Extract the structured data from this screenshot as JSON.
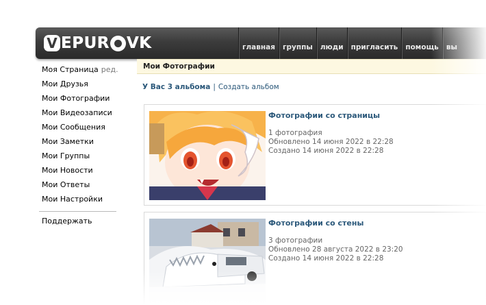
{
  "header": {
    "logo_text": "EPUR",
    "logo_suffix": "VK",
    "nav": [
      "главная",
      "группы",
      "люди",
      "пригласить",
      "помощь",
      "вы"
    ]
  },
  "sidebar": {
    "items": [
      {
        "label": "Моя Страница",
        "extra": "ред."
      },
      {
        "label": "Мои Друзья"
      },
      {
        "label": "Мои Фотографии"
      },
      {
        "label": "Мои Видеозаписи"
      },
      {
        "label": "Мои Сообщения"
      },
      {
        "label": "Мои Заметки"
      },
      {
        "label": "Мои Группы"
      },
      {
        "label": "Мои Новости"
      },
      {
        "label": "Мои Ответы"
      },
      {
        "label": "Мои Настройки"
      }
    ],
    "support": "Поддержать"
  },
  "main": {
    "title": "Мои Фотографии",
    "albums_count": "У Вас 3 альбома",
    "pipe": "|",
    "create_album": "Создать альбом",
    "albums": [
      {
        "title": "Фотографии со страницы",
        "count": "1 фотография",
        "updated": "Обновлено 14 июня 2022 в 22:28",
        "created": "Создано 14 июня 2022 в 22:28"
      },
      {
        "title": "Фотографии со стены",
        "count": "3 фотографии",
        "updated": "Обновлено 28 августа 2022 в 23:20",
        "created": "Создано 14 июня 2022 в 22:28"
      }
    ]
  },
  "colors": {
    "link": "#2b587a",
    "title_bar_bg": "#fdf8e1",
    "header_bg": "#3c3c3c"
  }
}
